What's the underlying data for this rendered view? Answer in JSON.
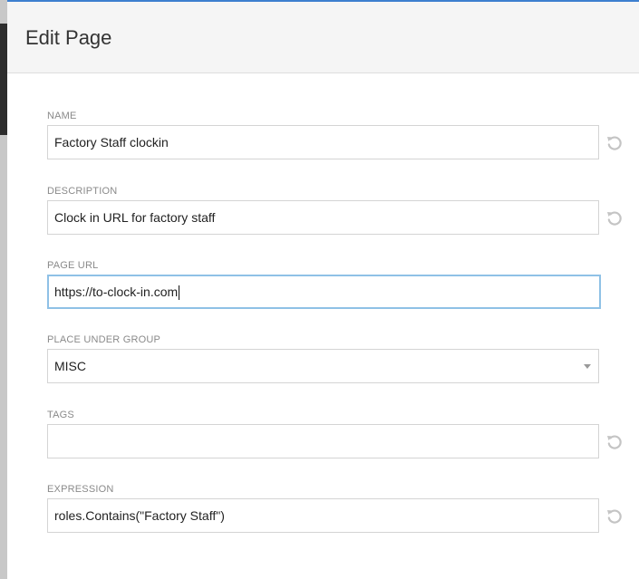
{
  "dialog": {
    "title": "Edit Page"
  },
  "fields": {
    "name": {
      "label": "NAME",
      "value": "Factory Staff clockin"
    },
    "description": {
      "label": "DESCRIPTION",
      "value": "Clock in URL for factory staff"
    },
    "page_url": {
      "label": "PAGE URL",
      "value": "https://to-clock-in.com"
    },
    "group": {
      "label": "PLACE UNDER GROUP",
      "value": "MISC"
    },
    "tags": {
      "label": "TAGS",
      "value": ""
    },
    "expression": {
      "label": "EXPRESSION",
      "value": "roles.Contains(\"Factory Staff\")"
    }
  },
  "colors": {
    "accent_top_border": "#3d7fcf",
    "focus_border": "#8fc1e6",
    "header_bg": "#f5f5f5"
  },
  "icons": {
    "reset": "undo-icon",
    "dropdown": "chevron-down-icon"
  }
}
